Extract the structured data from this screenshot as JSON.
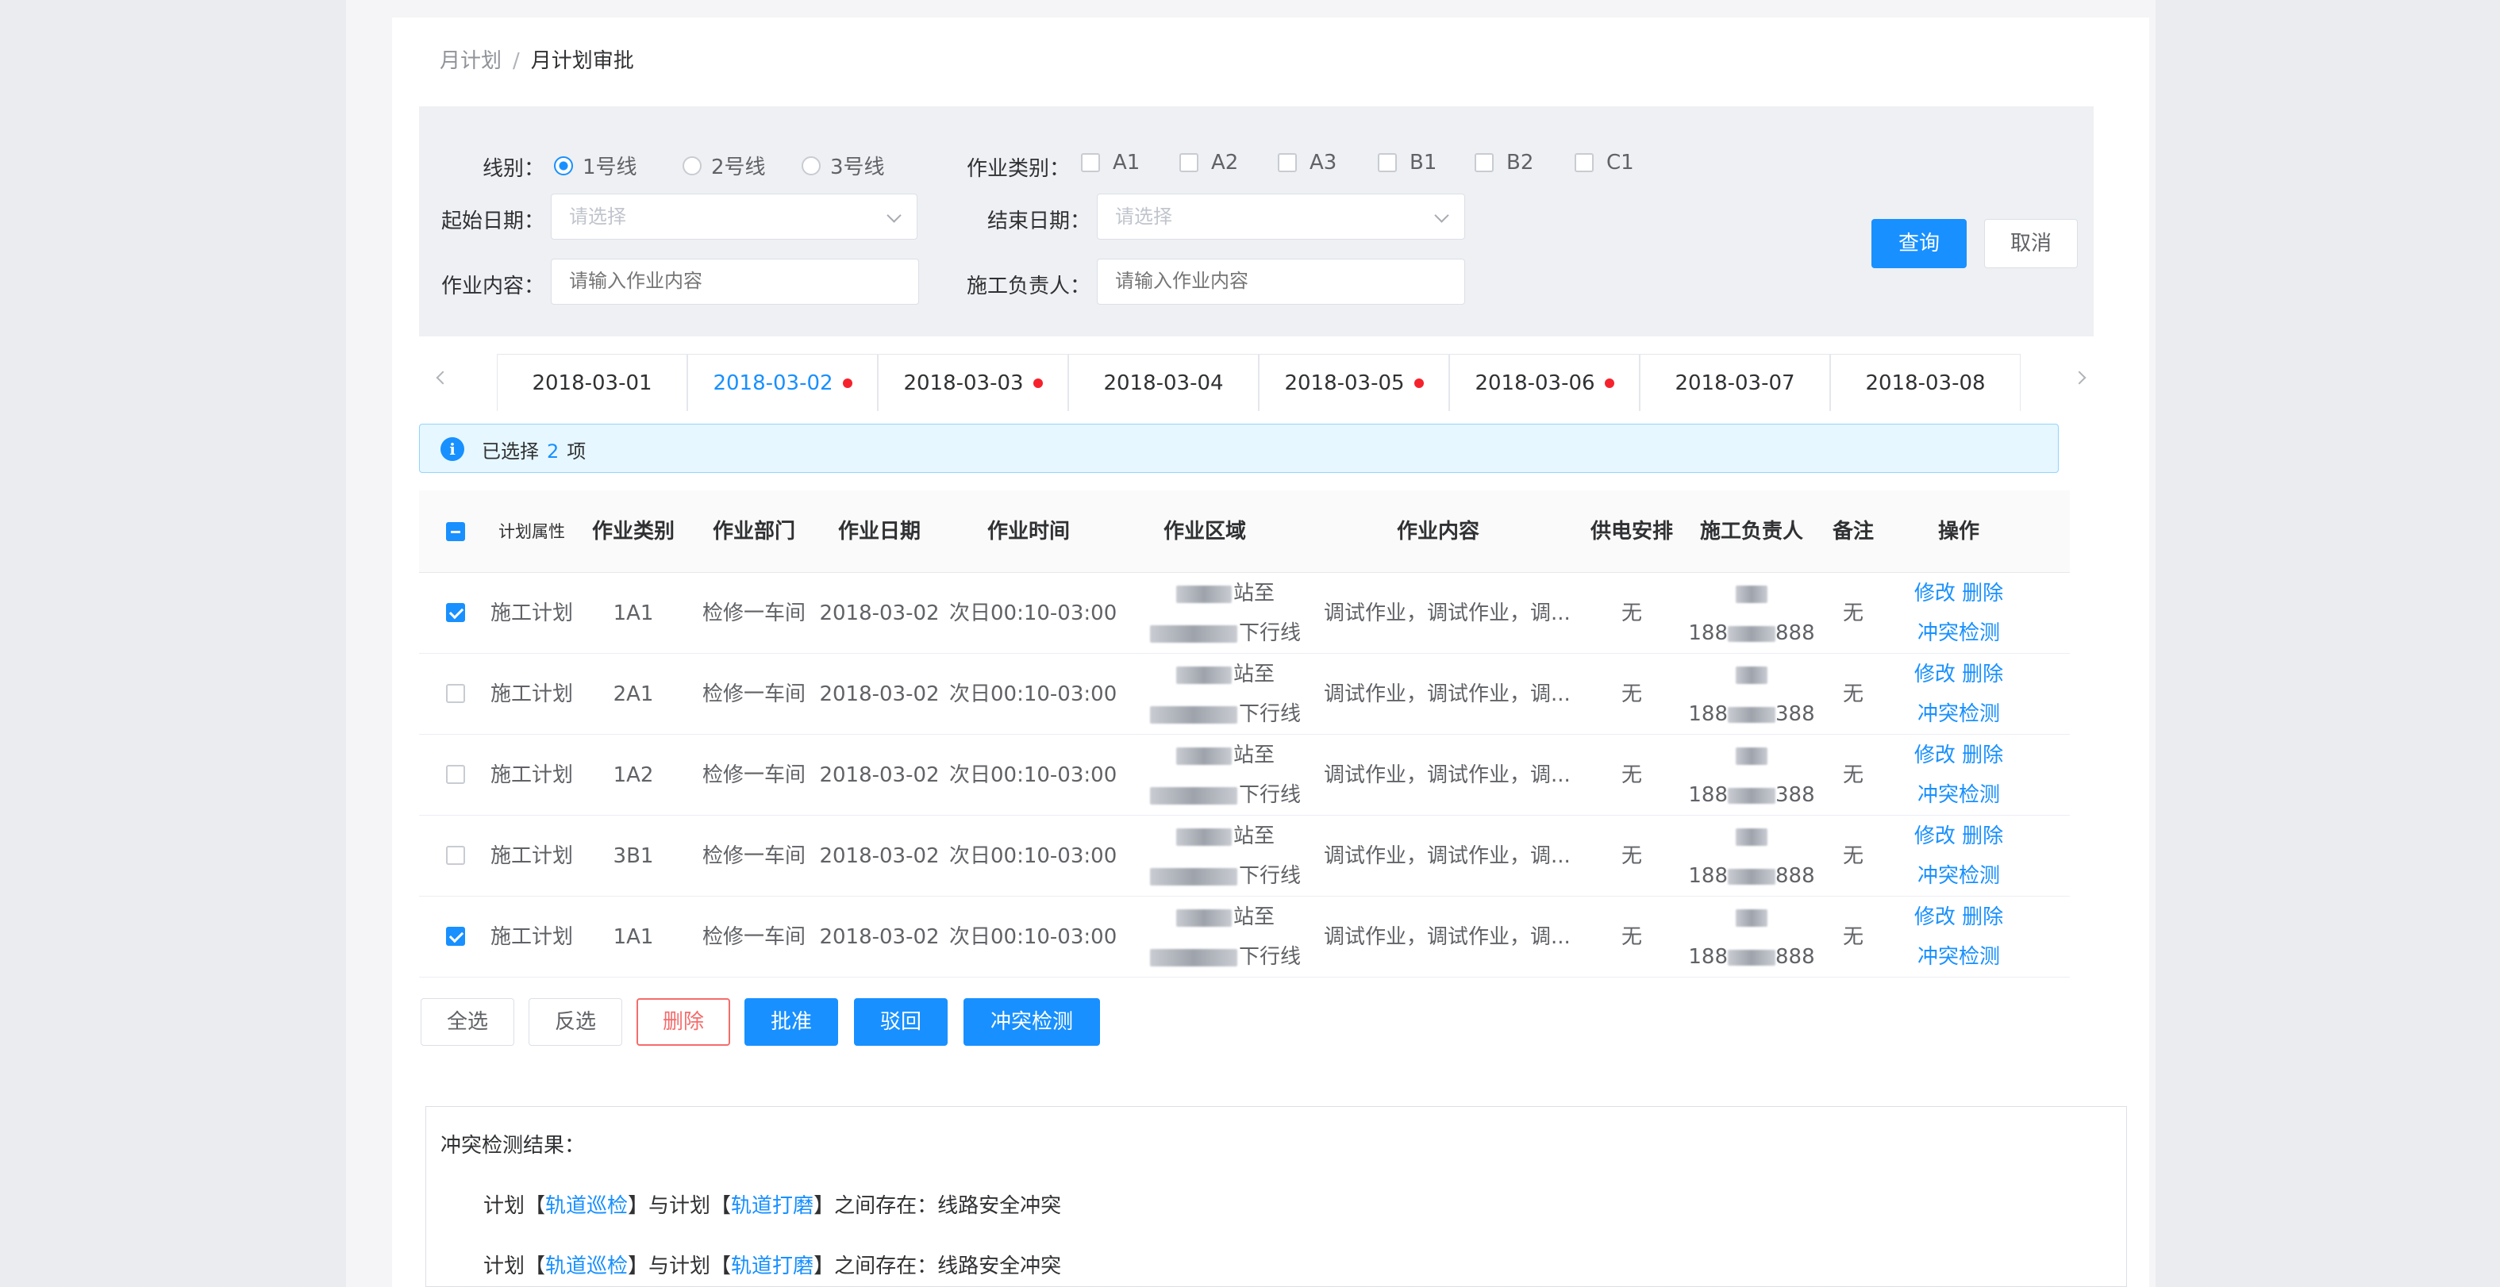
{
  "breadcrumb": {
    "parent": "月计划",
    "separator": "/",
    "current": "月计划审批"
  },
  "filters": {
    "line_label": "线别：",
    "line_options": [
      {
        "label": "1号线",
        "selected": true
      },
      {
        "label": "2号线",
        "selected": false
      },
      {
        "label": "3号线",
        "selected": false
      }
    ],
    "category_label": "作业类别：",
    "category_options": [
      {
        "label": "A1",
        "checked": false
      },
      {
        "label": "A2",
        "checked": false
      },
      {
        "label": "A3",
        "checked": false
      },
      {
        "label": "B1",
        "checked": false
      },
      {
        "label": "B2",
        "checked": false
      },
      {
        "label": "C1",
        "checked": false
      }
    ],
    "start_date_label": "起始日期：",
    "start_date_placeholder": "请选择",
    "end_date_label": "结束日期：",
    "end_date_placeholder": "请选择",
    "content_label": "作业内容：",
    "content_placeholder": "请输入作业内容",
    "leader_label": "施工负责人：",
    "leader_placeholder": "请输入作业内容",
    "query_button": "查询",
    "cancel_button": "取消"
  },
  "date_tabs": [
    {
      "label": "2018-03-01",
      "has_dot": false,
      "active": false
    },
    {
      "label": "2018-03-02",
      "has_dot": true,
      "active": true
    },
    {
      "label": "2018-03-03",
      "has_dot": true,
      "active": false
    },
    {
      "label": "2018-03-04",
      "has_dot": false,
      "active": false
    },
    {
      "label": "2018-03-05",
      "has_dot": true,
      "active": false
    },
    {
      "label": "2018-03-06",
      "has_dot": true,
      "active": false
    },
    {
      "label": "2018-03-07",
      "has_dot": false,
      "active": false
    },
    {
      "label": "2018-03-08",
      "has_dot": false,
      "active": false
    }
  ],
  "selection_alert": {
    "prefix": "已选择",
    "count": "2",
    "suffix": "项"
  },
  "table": {
    "headers": {
      "plan_type": "计划属性",
      "category": "作业类别",
      "dept": "作业部门",
      "date": "作业日期",
      "time": "作业时间",
      "area": "作业区域",
      "content": "作业内容",
      "power": "供电安排",
      "leader": "施工负责人",
      "remark": "备注",
      "action": "操作"
    },
    "rows": [
      {
        "checked": true,
        "plan_type": "施工计划",
        "category": "1A1",
        "dept": "检修一车间",
        "date": "2018-03-02",
        "time": "次日00:10-03:00",
        "area_1": "站至",
        "area_2": "下行线",
        "content": "调试作业，调试作业，调...",
        "power": "无",
        "phone_prefix": "188",
        "phone_suffix": "888",
        "remark": "无",
        "action_edit": "修改",
        "action_delete": "删除",
        "action_check": "冲突检测"
      },
      {
        "checked": false,
        "plan_type": "施工计划",
        "category": "2A1",
        "dept": "检修一车间",
        "date": "2018-03-02",
        "time": "次日00:10-03:00",
        "area_1": "站至",
        "area_2": "下行线",
        "content": "调试作业，调试作业，调...",
        "power": "无",
        "phone_prefix": "188",
        "phone_suffix": "388",
        "remark": "无",
        "action_edit": "修改",
        "action_delete": "删除",
        "action_check": "冲突检测"
      },
      {
        "checked": false,
        "plan_type": "施工计划",
        "category": "1A2",
        "dept": "检修一车间",
        "date": "2018-03-02",
        "time": "次日00:10-03:00",
        "area_1": "站至",
        "area_2": "下行线",
        "content": "调试作业，调试作业，调...",
        "power": "无",
        "phone_prefix": "188",
        "phone_suffix": "388",
        "remark": "无",
        "action_edit": "修改",
        "action_delete": "删除",
        "action_check": "冲突检测"
      },
      {
        "checked": false,
        "plan_type": "施工计划",
        "category": "3B1",
        "dept": "检修一车间",
        "date": "2018-03-02",
        "time": "次日00:10-03:00",
        "area_1": "站至",
        "area_2": "下行线",
        "content": "调试作业，调试作业，调...",
        "power": "无",
        "phone_prefix": "188",
        "phone_suffix": "888",
        "remark": "无",
        "action_edit": "修改",
        "action_delete": "删除",
        "action_check": "冲突检测"
      },
      {
        "checked": true,
        "plan_type": "施工计划",
        "category": "1A1",
        "dept": "检修一车间",
        "date": "2018-03-02",
        "time": "次日00:10-03:00",
        "area_1": "站至",
        "area_2": "下行线",
        "content": "调试作业，调试作业，调...",
        "power": "无",
        "phone_prefix": "188",
        "phone_suffix": "888",
        "remark": "无",
        "action_edit": "修改",
        "action_delete": "删除",
        "action_check": "冲突检测"
      }
    ]
  },
  "bulk_actions": {
    "select_all": "全选",
    "invert": "反选",
    "delete": "删除",
    "approve": "批准",
    "reject": "驳回",
    "conflict_check": "冲突检测"
  },
  "conflict_result": {
    "title": "冲突检测结果：",
    "lines": [
      {
        "pre": "计划【",
        "plan_a": "轨道巡检",
        "mid": "】与计划【",
        "plan_b": "轨道打磨",
        "post": "】之间存在：线路安全冲突"
      },
      {
        "pre": "计划【",
        "plan_a": "轨道巡检",
        "mid": "】与计划【",
        "plan_b": "轨道打磨",
        "post": "】之间存在：线路安全冲突"
      }
    ]
  },
  "colors": {
    "primary": "#1890ff",
    "danger": "#f56c6c",
    "dot": "#f5222d",
    "alert_bg": "#e6f7ff"
  }
}
